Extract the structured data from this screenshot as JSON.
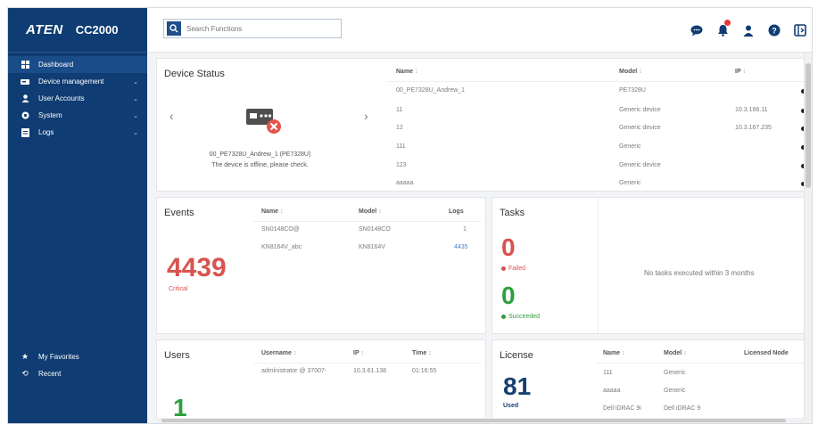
{
  "brand": {
    "logo": "ATEN",
    "model": "CC2000"
  },
  "nav": {
    "items": [
      {
        "label": "Dashboard",
        "icon": "grid-icon",
        "active": true,
        "expandable": false
      },
      {
        "label": "Device management",
        "icon": "device-icon",
        "expandable": true
      },
      {
        "label": "User Accounts",
        "icon": "user-icon",
        "expandable": true
      },
      {
        "label": "System",
        "icon": "gear-icon",
        "expandable": true
      },
      {
        "label": "Logs",
        "icon": "log-icon",
        "expandable": true
      }
    ],
    "bottom": [
      {
        "label": "My Favorites",
        "icon": "star-icon"
      },
      {
        "label": "Recent",
        "icon": "history-icon"
      }
    ]
  },
  "search": {
    "placeholder": "Search Functions",
    "value": ""
  },
  "topbar": {
    "icons": [
      "chat-icon",
      "notification-icon",
      "user-icon",
      "help-icon",
      "logout-icon"
    ],
    "notification_badge": true
  },
  "device_status": {
    "title": "Device Status",
    "caption_line1": "00_PE7328U_Andrew_1 (PE7328U)",
    "caption_line2": "The device is offline, please check.",
    "columns": {
      "name": "Name",
      "model": "Model",
      "ip": "IP"
    },
    "rows": [
      {
        "name": "00_PE7328U_Andrew_1",
        "model": "PE7328U",
        "ip": ""
      },
      {
        "name": "11",
        "model": "Generic device",
        "ip": "10.3.166.11"
      },
      {
        "name": "12",
        "model": "Generic device",
        "ip": "10.3.167.235"
      },
      {
        "name": "111",
        "model": "Generic",
        "ip": ""
      },
      {
        "name": "123",
        "model": "Generic device",
        "ip": ""
      },
      {
        "name": "aaaaa",
        "model": "Generic",
        "ip": ""
      }
    ]
  },
  "events": {
    "title": "Events",
    "count": "4439",
    "level": "Critical",
    "columns": {
      "name": "Name",
      "model": "Model",
      "logs": "Logs"
    },
    "rows": [
      {
        "name": "SN0148CO@",
        "model": "SN0148CO",
        "logs": "1"
      },
      {
        "name": "KN8164V_abc",
        "model": "KN8164V",
        "logs": "4435"
      }
    ]
  },
  "tasks": {
    "title": "Tasks",
    "failed_count": "0",
    "failed_label": "Failed",
    "succeeded_count": "0",
    "succeeded_label": "Succeeded",
    "empty_message": "No tasks executed within 3 months"
  },
  "users": {
    "title": "Users",
    "count": "1",
    "columns": {
      "username": "Username",
      "ip": "IP",
      "time": "Time"
    },
    "rows": [
      {
        "username": "administrator @ 37007-",
        "ip": "10.3.61.138",
        "time": "01:16:55"
      }
    ]
  },
  "license": {
    "title": "License",
    "count": "81",
    "count_label": "Used",
    "columns": {
      "name": "Name",
      "model": "Model",
      "licensed": "Licensed Node"
    },
    "rows": [
      {
        "name": "111",
        "model": "Generic"
      },
      {
        "name": "aaaaa",
        "model": "Generic"
      },
      {
        "name": "Dell iDRAC 9i",
        "model": "Dell iDRAC 9"
      }
    ]
  },
  "colors": {
    "sidebar": "#0f3c72",
    "critical": "#d9534f",
    "success": "#2e9e3e",
    "license_number": "#16406e",
    "badge": "#e53935"
  }
}
